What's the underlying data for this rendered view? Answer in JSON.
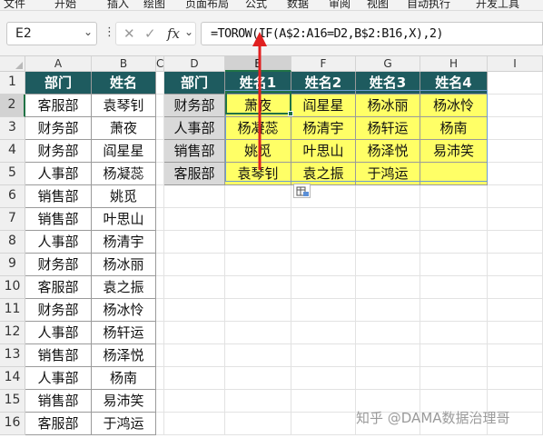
{
  "ribbon": {
    "menu_items": [
      "文件",
      "开始",
      "插入",
      "绘图",
      "页面布局",
      "公式",
      "数据",
      "审阅",
      "视图",
      "自动执行",
      "开发工具"
    ]
  },
  "formula_bar": {
    "name_box": "E2",
    "cancel_icon": "✕",
    "enter_icon": "✓",
    "fx_label": "fx",
    "formula": "=TOROW(IF(A$2:A16=D2,B$2:B16,X),2)"
  },
  "columns": [
    "A",
    "B",
    "C",
    "D",
    "E",
    "F",
    "G",
    "H",
    "I"
  ],
  "rows": [
    "1",
    "2",
    "3",
    "4",
    "5",
    "6",
    "7",
    "8",
    "9",
    "10",
    "11",
    "12",
    "13",
    "14",
    "15",
    "16"
  ],
  "source_table": {
    "headers": [
      "部门",
      "姓名"
    ],
    "rows": [
      [
        "客服部",
        "袁琴钊"
      ],
      [
        "财务部",
        "萧夜"
      ],
      [
        "财务部",
        "阎星星"
      ],
      [
        "人事部",
        "杨凝蕊"
      ],
      [
        "销售部",
        "姚觅"
      ],
      [
        "销售部",
        "叶思山"
      ],
      [
        "人事部",
        "杨清宇"
      ],
      [
        "财务部",
        "杨冰丽"
      ],
      [
        "客服部",
        "袁之振"
      ],
      [
        "财务部",
        "杨冰怜"
      ],
      [
        "人事部",
        "杨轩运"
      ],
      [
        "销售部",
        "杨泽悦"
      ],
      [
        "人事部",
        "杨南"
      ],
      [
        "销售部",
        "易沛笑"
      ],
      [
        "客服部",
        "于鸿运"
      ]
    ]
  },
  "result_table": {
    "headers": [
      "部门",
      "姓名1",
      "姓名2",
      "姓名3",
      "姓名4"
    ],
    "rows": [
      [
        "财务部",
        "萧夜",
        "阎星星",
        "杨冰丽",
        "杨冰怜"
      ],
      [
        "人事部",
        "杨凝蕊",
        "杨清宇",
        "杨轩运",
        "杨南"
      ],
      [
        "销售部",
        "姚觅",
        "叶思山",
        "杨泽悦",
        "易沛笑"
      ],
      [
        "客服部",
        "袁琴钊",
        "袁之振",
        "于鸿运",
        ""
      ]
    ]
  },
  "selected_cell": "E2",
  "icons": {
    "paste_options": "paste-options-icon",
    "arrow": "red-arrow-annotation"
  },
  "colors": {
    "header_fill": "#1e5b5f",
    "highlight_fill": "#ffff66",
    "dept_fill": "#d9d9d9",
    "selection": "#217346",
    "arrow": "#e02020"
  },
  "watermark": "知乎 @DAMA数据治理哥"
}
